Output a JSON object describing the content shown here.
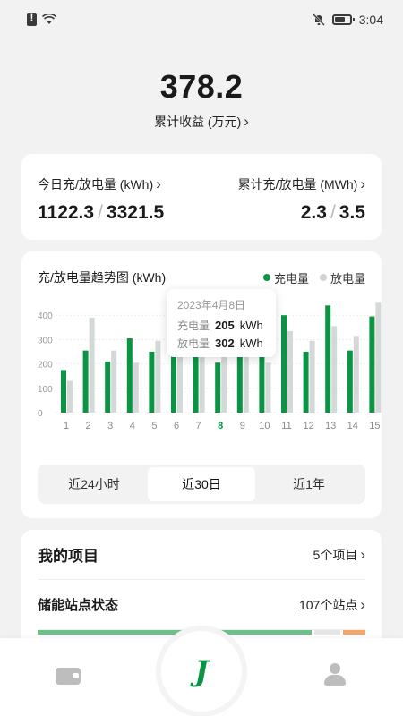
{
  "status_bar": {
    "time": "3:04"
  },
  "hero": {
    "value": "378.2",
    "label": "累计收益 (万元)"
  },
  "energy": {
    "today_label": "今日充/放电量 (kWh)",
    "today_charge": "1122.3",
    "today_discharge": "3321.5",
    "total_label": "累计充/放电量 (MWh)",
    "total_charge": "2.3",
    "total_discharge": "3.5",
    "separator": "/"
  },
  "chart_card": {
    "title": "充/放电量趋势图 (kWh)",
    "legend_charge": "充电量",
    "legend_discharge": "放电量",
    "tooltip": {
      "date": "2023年4月8日",
      "charge_label": "充电量",
      "charge_value": "205",
      "discharge_label": "放电量",
      "discharge_value": "302",
      "unit": "kWh"
    },
    "range_tabs": [
      "近24小时",
      "近30日",
      "近1年"
    ]
  },
  "chart_data": {
    "type": "bar",
    "categories": [
      "1",
      "2",
      "3",
      "4",
      "5",
      "6",
      "7",
      "8",
      "9",
      "10",
      "11",
      "12",
      "13",
      "14",
      "15"
    ],
    "series": [
      {
        "name": "充电量",
        "values": [
          175,
          255,
          210,
          305,
          250,
          295,
          255,
          205,
          285,
          285,
          400,
          250,
          440,
          255,
          395
        ]
      },
      {
        "name": "放电量",
        "values": [
          130,
          390,
          255,
          205,
          295,
          300,
          310,
          302,
          300,
          205,
          335,
          295,
          355,
          315,
          455
        ]
      }
    ],
    "yticks": [
      0,
      100,
      200,
      300,
      400,
      500
    ],
    "ylim": [
      0,
      500
    ],
    "highlight_category": "8",
    "colors": {
      "charge": "#0b9444",
      "discharge": "#d4d8d6",
      "highlight_tick": "#0b9444"
    }
  },
  "projects": {
    "title": "我的项目",
    "count": "5个项目",
    "station_title": "储能站点状态",
    "station_count": "107个站点",
    "status_segments": [
      {
        "fraction": 0.85,
        "color": "#6cc18a"
      },
      {
        "fraction": 0.08,
        "color": "#e6e6e6"
      },
      {
        "fraction": 0.07,
        "color": "#f5a66a"
      }
    ]
  },
  "bottom_nav": {
    "home_glyph": "J"
  },
  "icons": [
    "sim-alert-icon",
    "wifi-icon",
    "mute-bell-icon",
    "battery-icon",
    "chevron-right-icon",
    "wallet-icon",
    "home-logo-icon",
    "user-icon"
  ]
}
